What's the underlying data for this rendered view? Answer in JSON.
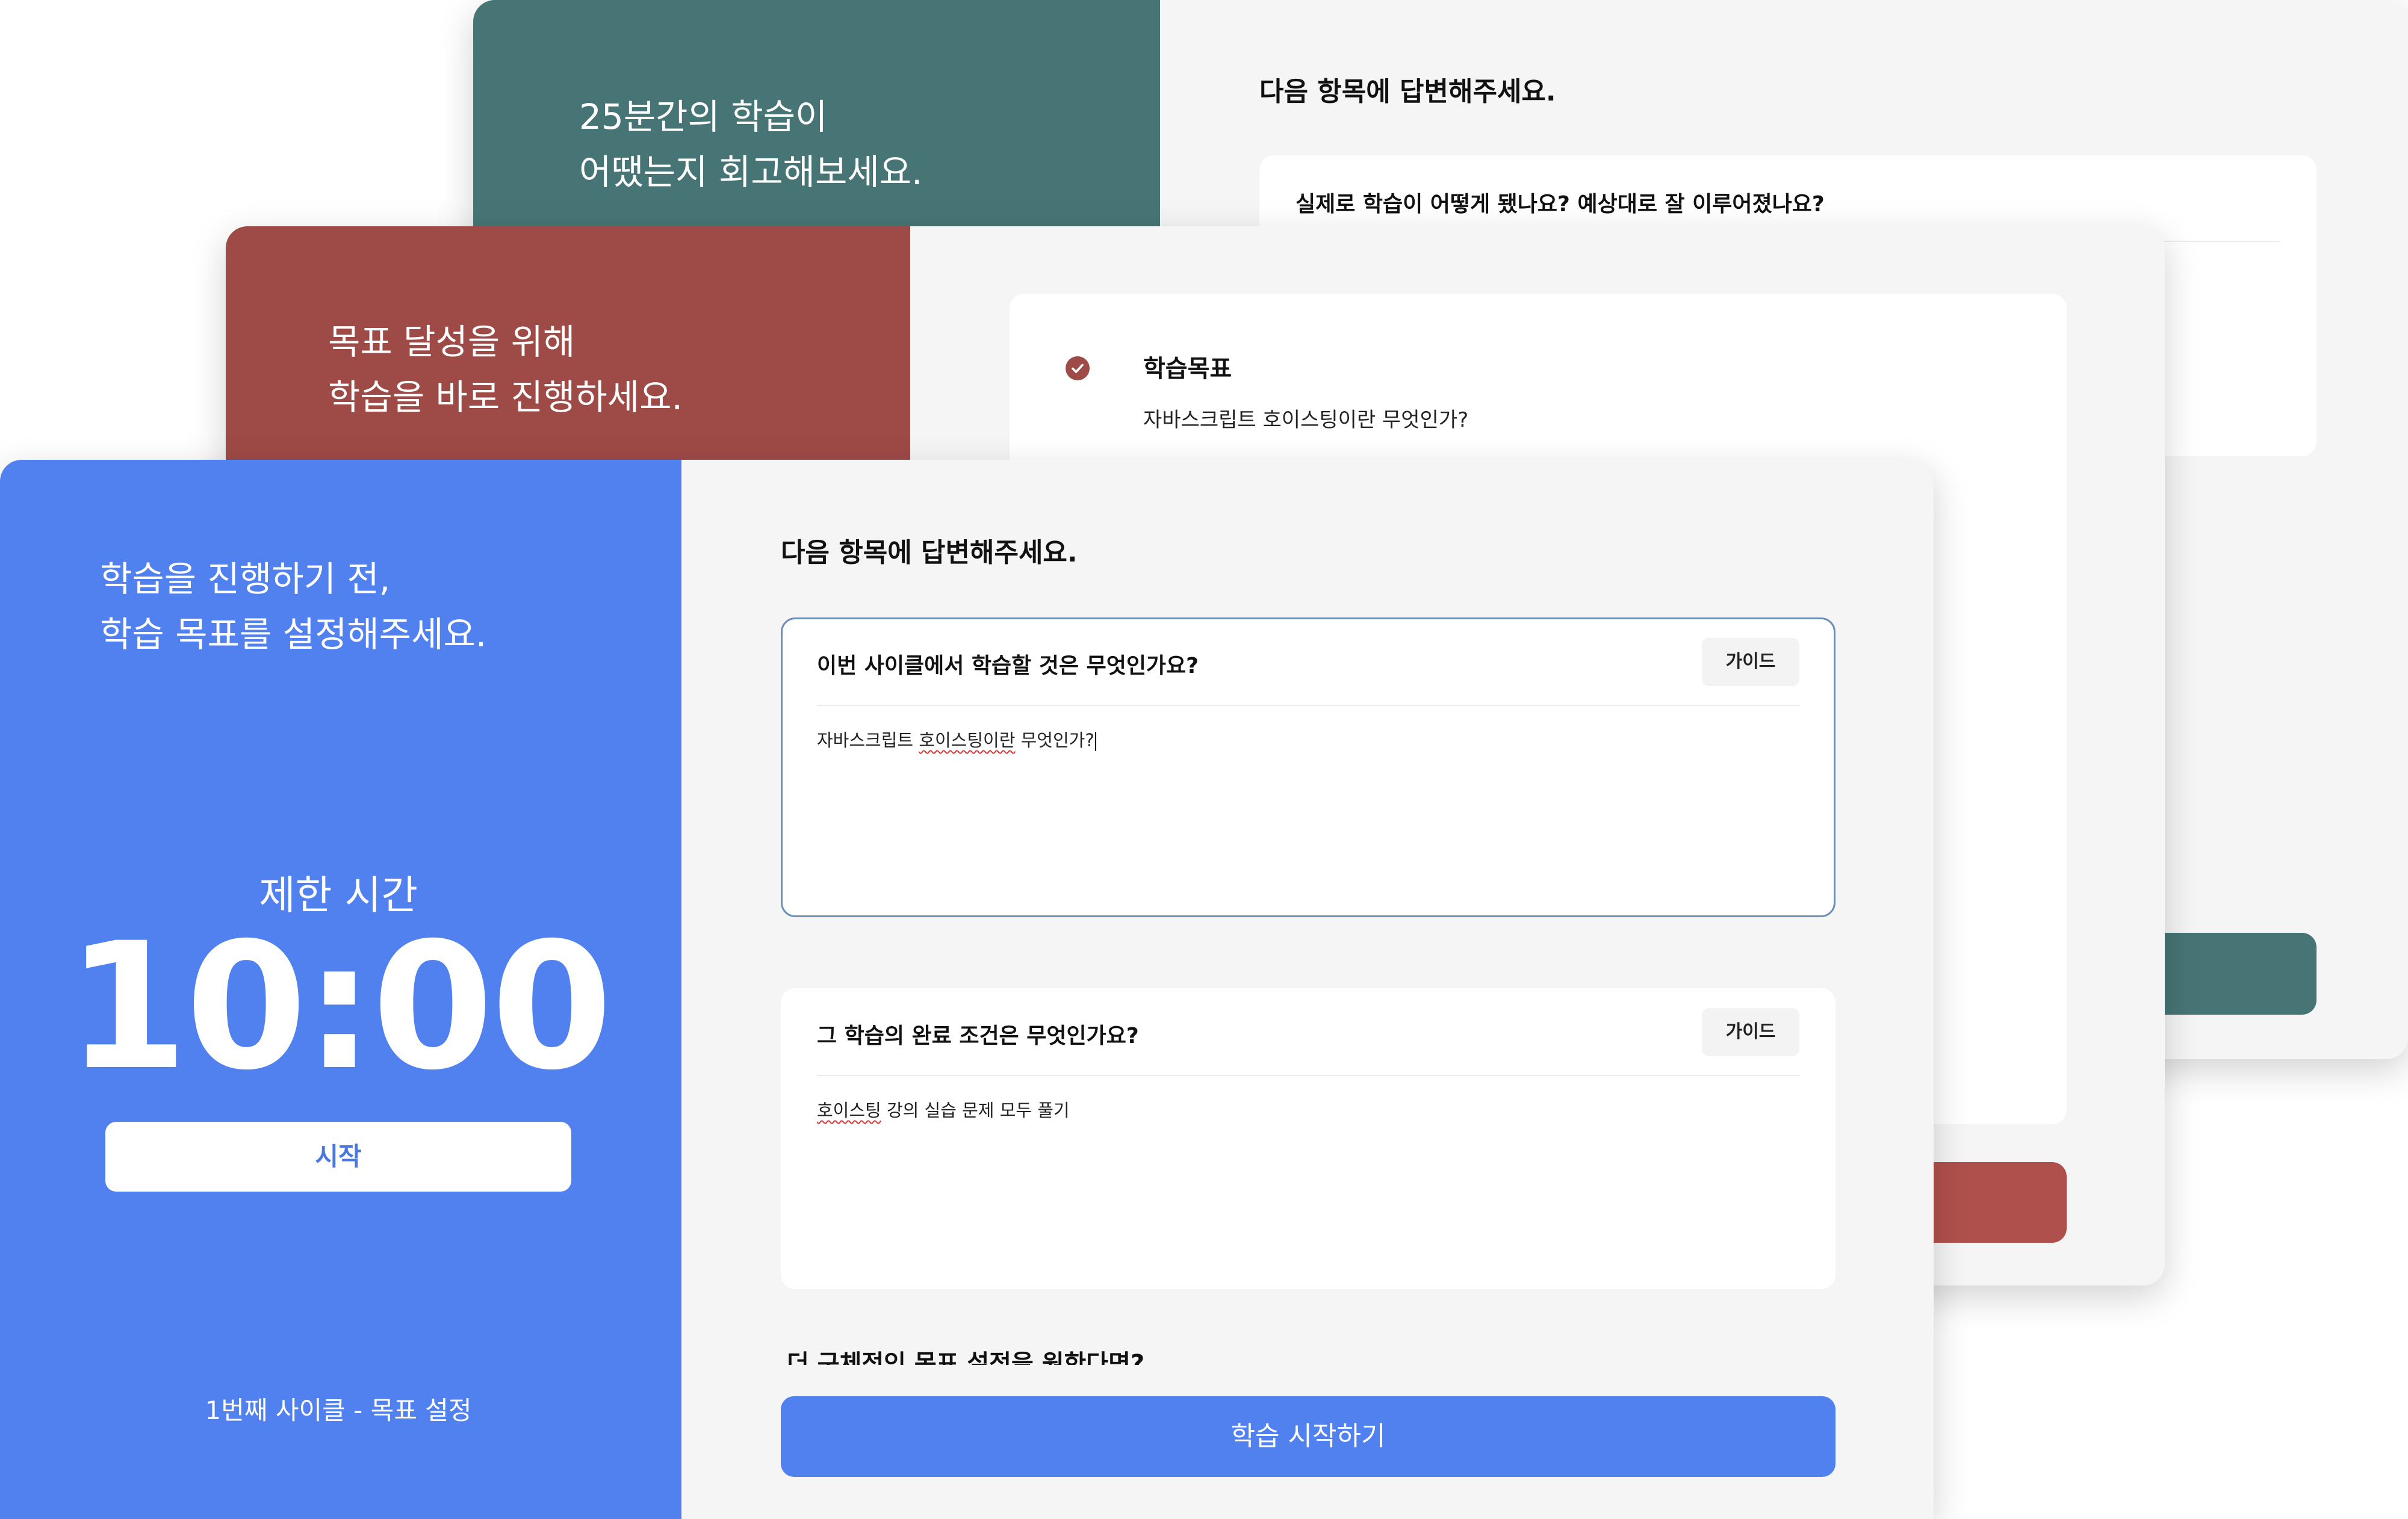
{
  "windows": {
    "reflect": {
      "hero_line1": "25분간의 학습이",
      "hero_line2": "어땠는지 회고해보세요.",
      "heading": "다음 항목에 답변해주세요.",
      "question": "실제로 학습이 어떻게 됐나요? 예상대로 잘 이루어졌나요?"
    },
    "progress": {
      "hero_line1": "목표 달성을 위해",
      "hero_line2": "학습을 바로 진행하세요.",
      "goal_title": "학습목표",
      "goal_value": "자바스크립트 호이스팅이란 무엇인가?"
    },
    "setup": {
      "hero_line1": "학습을 진행하기 전,",
      "hero_line2": "학습 목표를 설정해주세요.",
      "timer_label": "제한 시간",
      "timer_value": "10:00",
      "start_button": "시작",
      "cycle_text": "1번째 사이클 - 목표 설정",
      "heading": "다음 항목에 답변해주세요.",
      "questions": [
        {
          "question": "이번 사이클에서 학습할 것은 무엇인가요?",
          "guide": "가이드",
          "answer": "자바스크립트 호이스팅이란 무엇인가?",
          "answer_plain": "자바스크립트 ",
          "answer_flagged": "호이스팅이란",
          "answer_rest": " 무엇인가?"
        },
        {
          "question": "그 학습의 완료 조건은 무엇인가요?",
          "guide": "가이드",
          "answer": "호이스팅 강의 실습 문제 모두 풀기",
          "answer_plain": "",
          "answer_flagged": "호이스팅",
          "answer_rest": " 강의 실습 문제 모두 풀기"
        }
      ],
      "cut_off_question": "더 구체적인 목표 설정을 원한다면?",
      "submit_button": "학습 시작하기"
    }
  },
  "colors": {
    "teal": "#477575",
    "red": "#9e4a47",
    "blue": "#5081ee",
    "panel_bg": "#f5f5f5",
    "focus_border": "#6d8fb8"
  }
}
